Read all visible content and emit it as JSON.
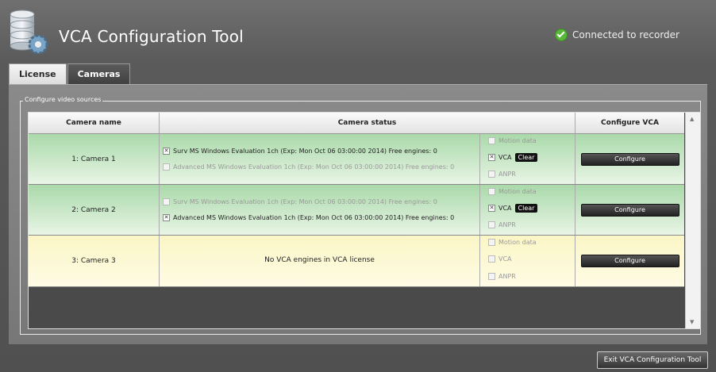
{
  "header": {
    "app_icon": "database-gear-icon",
    "title": "VCA Configuration Tool",
    "status_icon": "check-circle-icon",
    "status": "Connected to recorder"
  },
  "tabs": [
    {
      "label": "License",
      "active": false
    },
    {
      "label": "Cameras",
      "active": true
    }
  ],
  "group_label": "Configure video sources",
  "table": {
    "columns": [
      "Camera name",
      "Camera status",
      "Configure VCA"
    ],
    "rows": [
      {
        "name": "1: Camera 1",
        "licenses": [
          {
            "text": "Surv MS Windows Evaluation 1ch (Exp: Mon Oct 06 03:00:00 2014) Free engines: 0",
            "checked": true,
            "enabled": true
          },
          {
            "text": "Advanced MS Windows Evaluation 1ch (Exp: Mon Oct 06 03:00:00 2014) Free engines: 0",
            "checked": false,
            "enabled": false
          }
        ],
        "engines": [
          {
            "label": "Motion data",
            "checked": false,
            "enabled": false
          },
          {
            "label": "VCA",
            "checked": true,
            "enabled": true,
            "clear_label": "Clear"
          },
          {
            "label": "ANPR",
            "checked": false,
            "enabled": false
          }
        ],
        "configure_label": "Configure"
      },
      {
        "name": "2: Camera 2",
        "licenses": [
          {
            "text": "Surv MS Windows Evaluation 1ch (Exp: Mon Oct 06 03:00:00 2014) Free engines: 0",
            "checked": false,
            "enabled": false
          },
          {
            "text": "Advanced MS Windows Evaluation 1ch (Exp: Mon Oct 06 03:00:00 2014) Free engines: 0",
            "checked": true,
            "enabled": true
          }
        ],
        "engines": [
          {
            "label": "Motion data",
            "checked": false,
            "enabled": false
          },
          {
            "label": "VCA",
            "checked": true,
            "enabled": true,
            "clear_label": "Clear"
          },
          {
            "label": "ANPR",
            "checked": false,
            "enabled": false
          }
        ],
        "configure_label": "Configure"
      },
      {
        "name": "3: Camera 3",
        "no_license_text": "No VCA engines in VCA license",
        "engines": [
          {
            "label": "Motion data",
            "checked": false,
            "enabled": false
          },
          {
            "label": "VCA",
            "checked": false,
            "enabled": false
          },
          {
            "label": "ANPR",
            "checked": false,
            "enabled": false
          }
        ],
        "configure_label": "Configure"
      }
    ]
  },
  "exit_label": "Exit VCA Configuration Tool",
  "colors": {
    "row_green": "#a9d9a9",
    "row_yellow": "#fbf6c5",
    "status_ok": "#58b83a"
  }
}
